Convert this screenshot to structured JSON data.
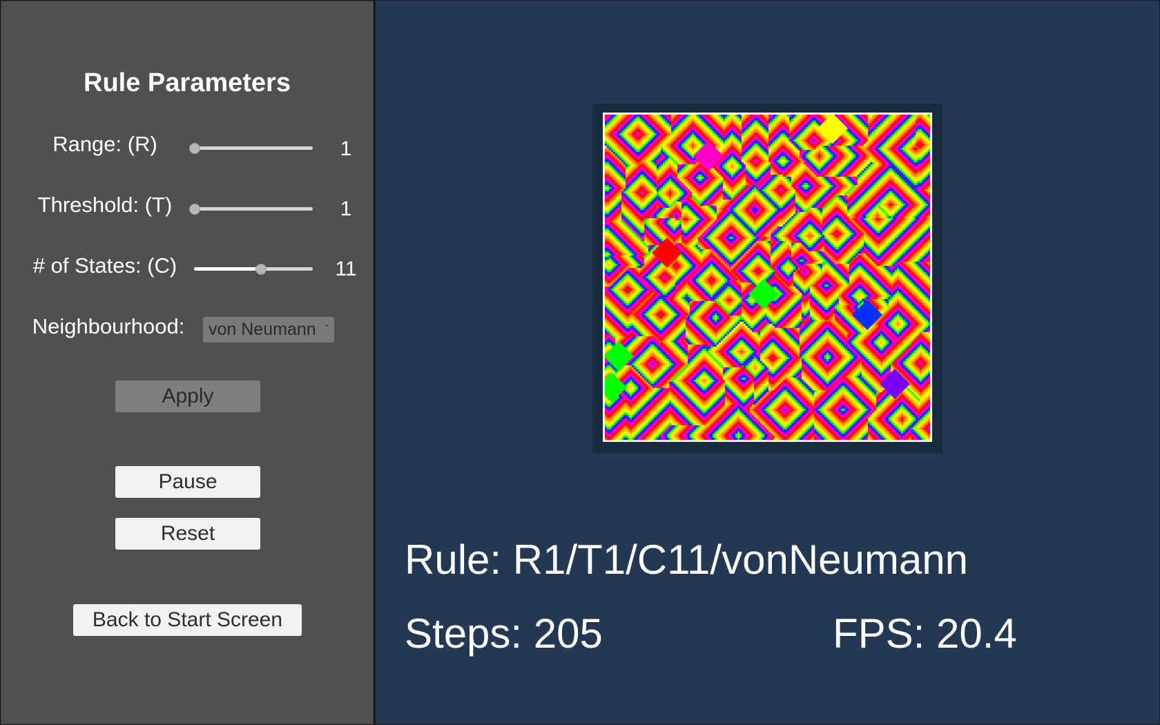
{
  "panel": {
    "title": "Rule Parameters",
    "range": {
      "label": "Range: (R)",
      "value": "1",
      "fraction": 0.0
    },
    "threshold": {
      "label": "Threshold: (T)",
      "value": "1",
      "fraction": 0.0
    },
    "states": {
      "label": "# of States: (C)",
      "value": "11",
      "fraction": 0.56
    },
    "neighbourhood": {
      "label": "Neighbourhood:",
      "selected": "von Neumann",
      "icon": "chevron-down-icon"
    },
    "apply_label": "Apply",
    "pause_label": "Pause",
    "reset_label": "Reset",
    "back_label": "Back to Start Screen"
  },
  "stats": {
    "rule": "Rule: R1/T1/C11/vonNeumann",
    "steps": "Steps: 205",
    "fps": "FPS: 20.4"
  },
  "simulation": {
    "state_colors": [
      "#ff0000",
      "#ff5500",
      "#ff9a00",
      "#ffd000",
      "#ffff00",
      "#b0ff00",
      "#00ff00",
      "#0030ff",
      "#7a00ff",
      "#ff00c8",
      "#ff0070"
    ]
  },
  "colors": {
    "panel_bg": "#505050",
    "main_bg": "#243853"
  }
}
